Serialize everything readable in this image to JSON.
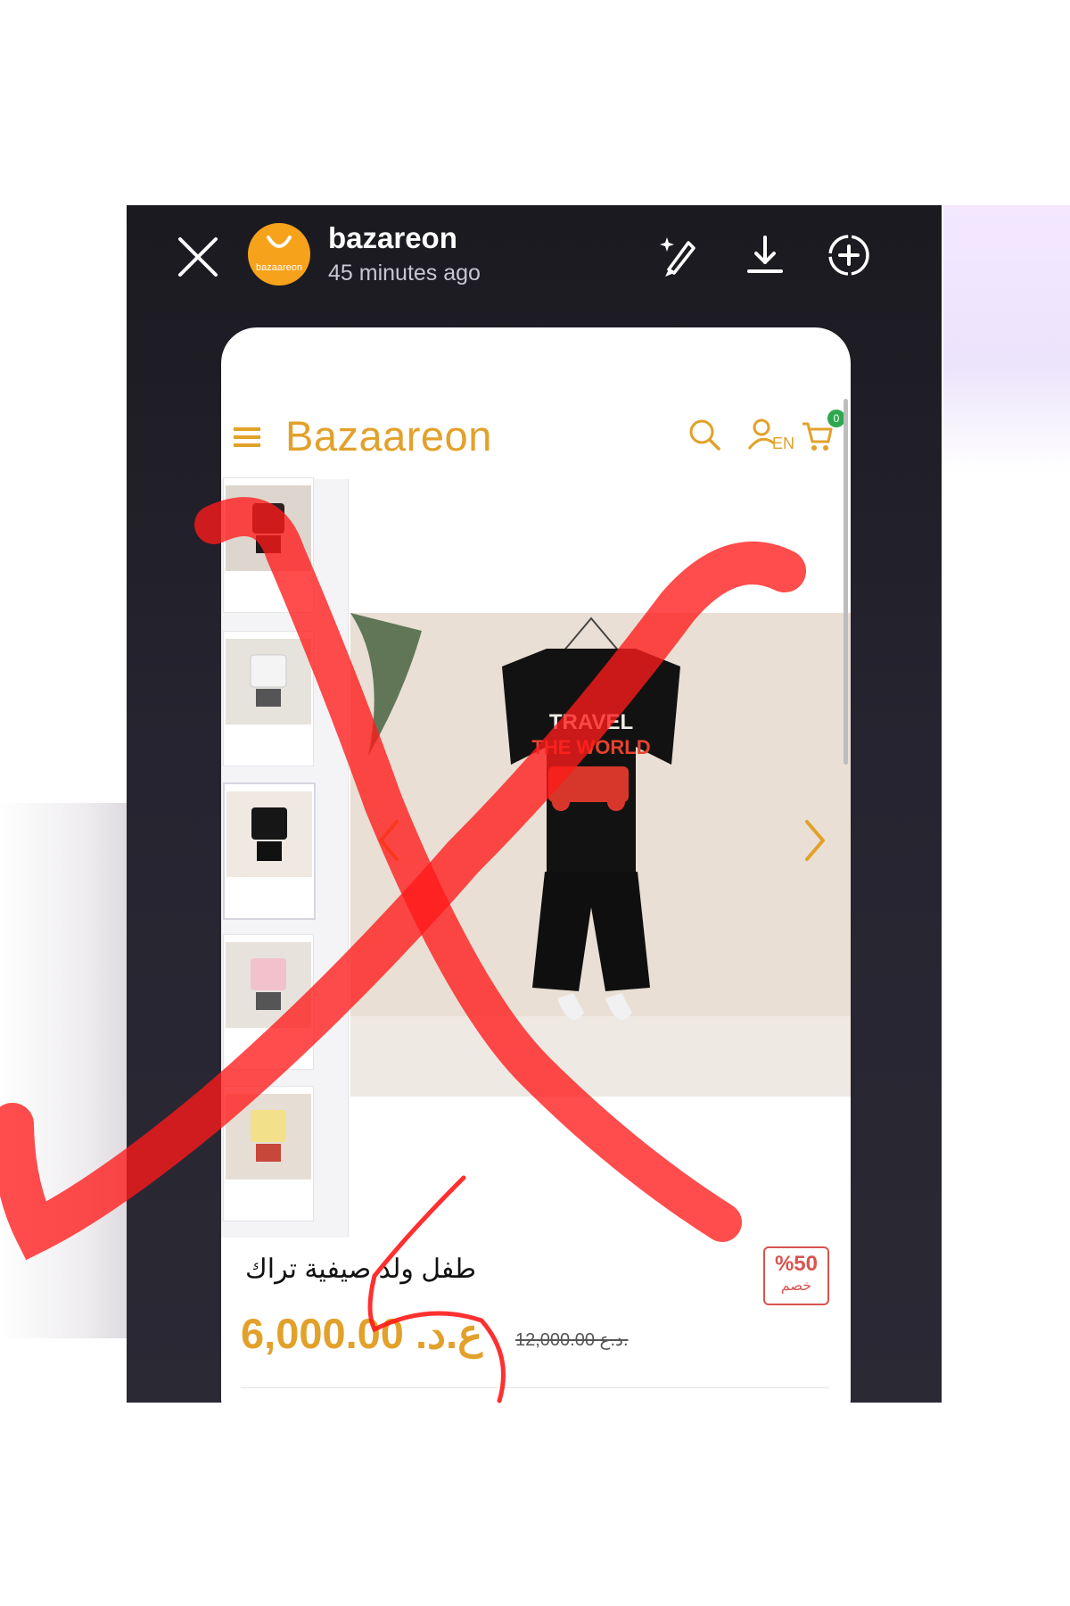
{
  "story": {
    "username": "bazareon",
    "time_ago": "45 minutes ago",
    "avatar_text": "bazaareon",
    "icons": [
      "close-icon",
      "draw-icon",
      "download-icon",
      "add-circle-icon"
    ]
  },
  "site": {
    "brand": "Bazaareon",
    "cart_count": "0",
    "lang_label": "EN",
    "icons": [
      "menu-icon",
      "search-icon",
      "account-icon",
      "cart-icon",
      "chevron-left-icon",
      "chevron-right-icon"
    ],
    "accent_color": "#e2a12b"
  },
  "product": {
    "title": "طفل ولد صيفية تراك",
    "discount_percent": "%50",
    "discount_label": "خصم",
    "price": "6,000.00 .ع.د",
    "old_price": "12,000.00 د.ع.",
    "shirt_print": "TRAVEL THE WORLD",
    "thumbnail_count": 5
  },
  "annotation": {
    "mark": "red X drawn over screenshot",
    "color": "#ff1a1a"
  }
}
